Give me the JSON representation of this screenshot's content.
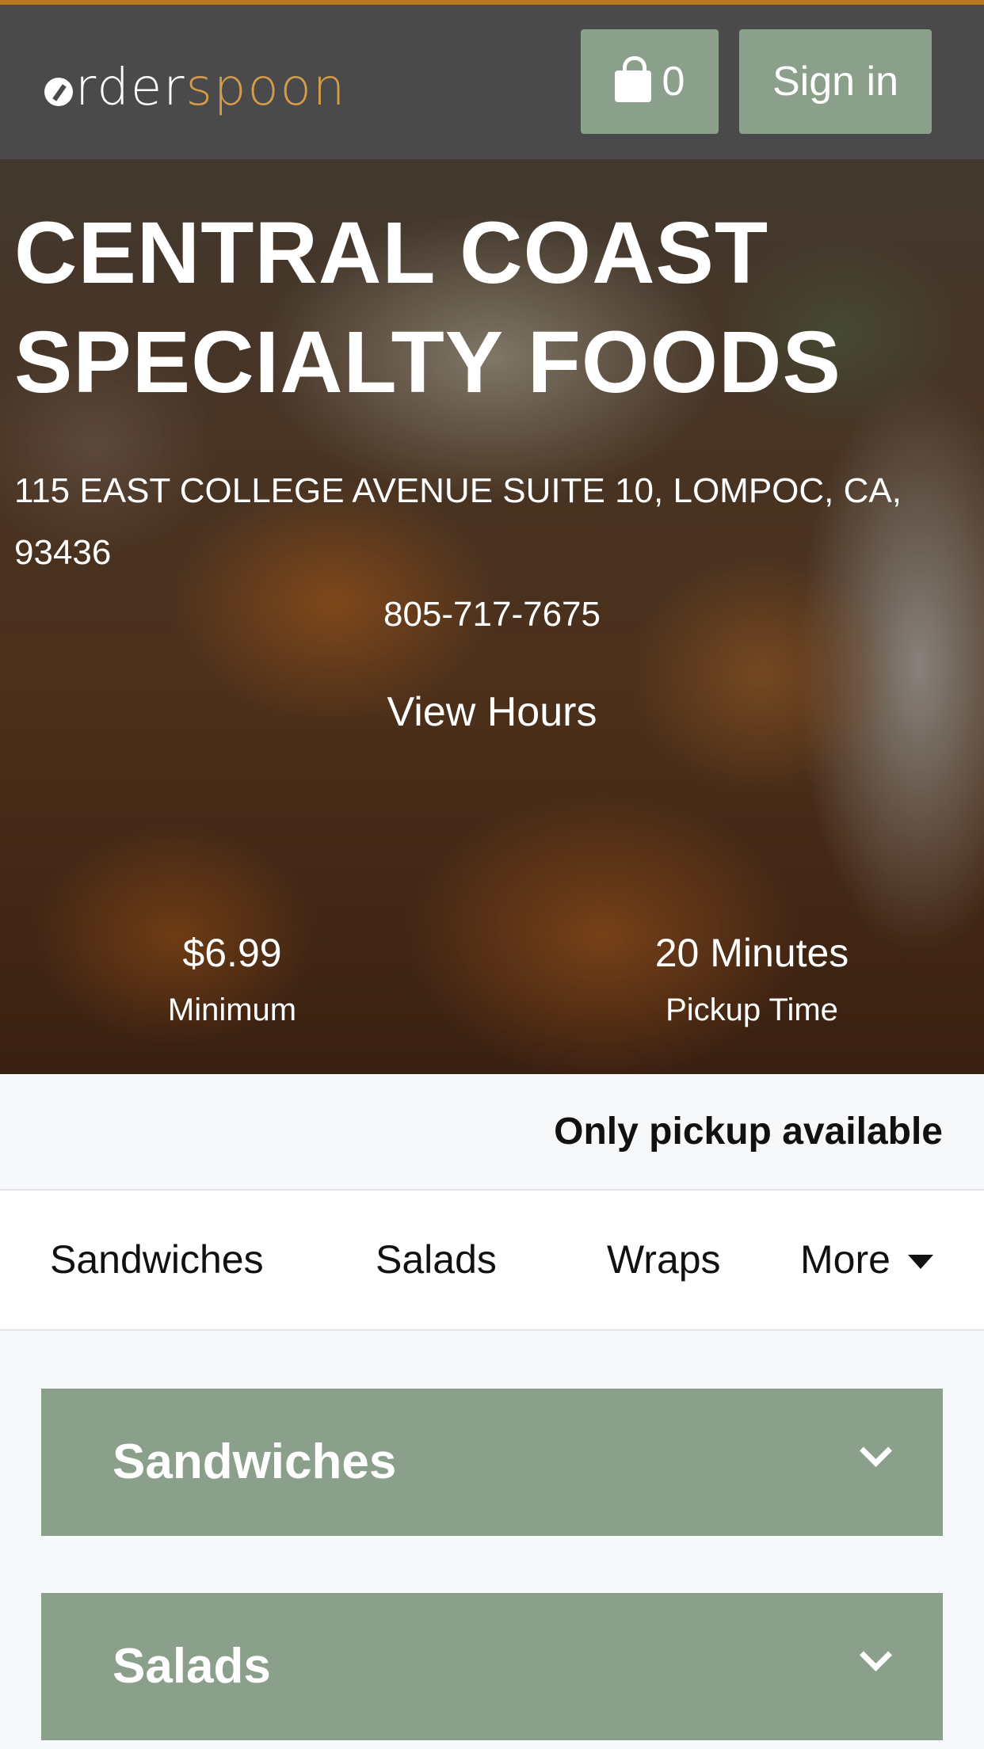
{
  "header": {
    "logo_part1": "rder",
    "logo_part2": "spoon",
    "cart_count": "0",
    "signin_label": "Sign in"
  },
  "hero": {
    "title": "CENTRAL COAST SPECIALTY FOODS",
    "address": "115 EAST COLLEGE AVENUE SUITE 10, LOMPOC, CA, 93436",
    "phone": "805-717-7675",
    "hours_link": "View Hours",
    "minimum_value": "$6.99",
    "minimum_label": "Minimum",
    "pickup_value": "20 Minutes",
    "pickup_label": "Pickup Time"
  },
  "pickup_notice": "Only pickup available",
  "category_nav": {
    "items": [
      "Sandwiches",
      "Salads",
      "Wraps"
    ],
    "more_label": "More"
  },
  "sections": [
    {
      "title": "Sandwiches"
    },
    {
      "title": "Salads"
    }
  ],
  "colors": {
    "accent_green": "#8aa08a",
    "header_bg": "#4a4a4a",
    "logo_orange": "#d39b4a",
    "top_accent": "#b8791e"
  },
  "icons": [
    "shopping-bag-icon",
    "caret-down-icon",
    "chevron-down-icon"
  ]
}
